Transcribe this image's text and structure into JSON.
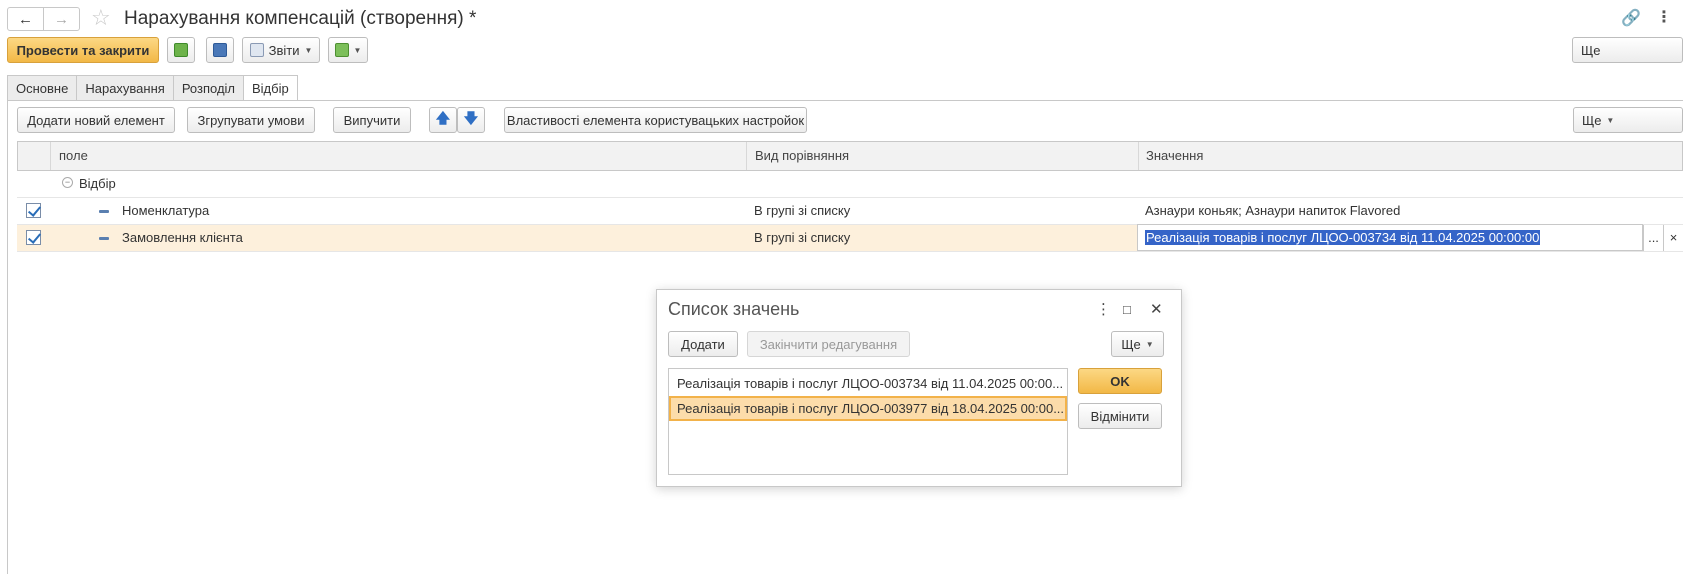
{
  "window": {
    "title": "Нарахування компенсацій (створення) *",
    "back_icon": "arrow-left-icon",
    "forward_icon": "arrow-right-icon"
  },
  "toolbar": {
    "post_and_close": "Провести та закрити",
    "reports": "Звіти",
    "more": "Ще"
  },
  "tabs": [
    {
      "label": "Основне",
      "active": false
    },
    {
      "label": "Нарахування",
      "active": false
    },
    {
      "label": "Розподіл",
      "active": false
    },
    {
      "label": "Відбір",
      "active": true
    }
  ],
  "filter_toolbar": {
    "add_new": "Додати новий елемент",
    "group_conditions": "Згрупувати умови",
    "exclude": "Випучити",
    "element_properties": "Властивості елемента користувацьких настройок",
    "more": "Ще"
  },
  "table": {
    "columns": [
      "поле",
      "Вид порівняння",
      "Значення"
    ],
    "group_row": "Відбір",
    "rows": [
      {
        "checked": true,
        "field": "Номенклатура",
        "comparison": "В групі зі списку",
        "value": "Азнаури коньяк; Азнаури напиток Flavored",
        "selected": false
      },
      {
        "checked": true,
        "field": "Замовлення клієнта",
        "comparison": "В групі зі списку",
        "value": "Реалізація товарів і послуг ЛЦОО-003734 від 11.04.2025 00:00:00",
        "selected": true
      }
    ],
    "select_button": "...",
    "clear_button": "×"
  },
  "dialog": {
    "title": "Список значень",
    "add": "Додати",
    "finish_editing": "Закінчити редагування",
    "more": "Ще",
    "ok": "OK",
    "cancel": "Відмінити",
    "items": [
      {
        "text": "Реалізація товарів і послуг ЛЦОО-003734 від 11.04.2025 00:00...",
        "selected": false
      },
      {
        "text": "Реалізація товарів і послуг ЛЦОО-003977 від 18.04.2025 00:00...",
        "selected": true
      }
    ]
  },
  "colors": {
    "primary_button": "#f2b846",
    "selection_row": "#fdf0dc",
    "text_highlight": "#3564c8"
  }
}
